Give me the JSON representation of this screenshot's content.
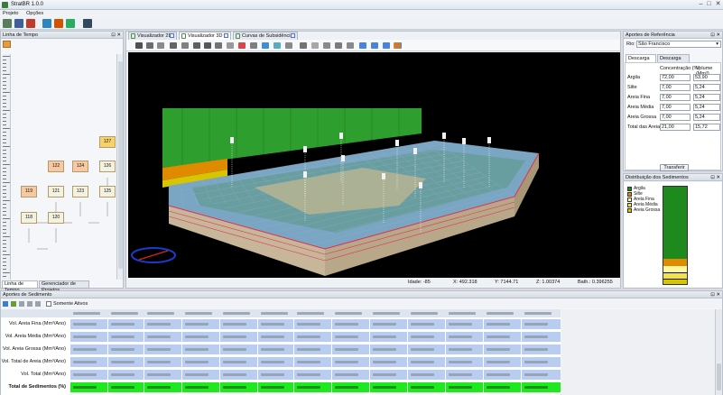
{
  "window": {
    "title": "StratBR 1.0.0"
  },
  "menu": [
    "Projeto",
    "Opções"
  ],
  "left_panel": {
    "title": "Linha de Tempo",
    "tabs": [
      "Linha de Tempo",
      "Gerenciador de Projetos"
    ],
    "nodes": [
      {
        "label": "127",
        "kind": "yellow"
      },
      {
        "label": "122",
        "kind": "orange"
      },
      {
        "label": "124",
        "kind": "orange"
      },
      {
        "label": "126",
        "kind": "plain"
      },
      {
        "label": "119",
        "kind": "orange"
      },
      {
        "label": "121",
        "kind": "plain"
      },
      {
        "label": "123",
        "kind": "plain"
      },
      {
        "label": "125",
        "kind": "plain"
      },
      {
        "label": "118",
        "kind": "plain"
      },
      {
        "label": "120",
        "kind": "plain"
      }
    ]
  },
  "center": {
    "tabs": [
      "Visualizador 2D",
      "Visualizador 3D",
      "Curvas de Subsidência"
    ],
    "active_tab": 1,
    "status": {
      "idade": "Idade: -85",
      "x": "X: 492.318",
      "y": "Y: 7144.71",
      "z": "Z: 1.00374",
      "bath": "Bath.: 0.396255"
    }
  },
  "right_panel": {
    "title": "Aportes de Referência",
    "rio_label": "Rio:",
    "rio_value": "São Francisco",
    "tabs": [
      "Descarga Mínima",
      "Descarga Máxima"
    ],
    "col_headers": [
      "Concentração (%)",
      "Volume (Mm³)"
    ],
    "rows": [
      {
        "name": "Argila",
        "conc": "72,00",
        "vol": "53,90"
      },
      {
        "name": "Silte",
        "conc": "7,00",
        "vol": "5,24"
      },
      {
        "name": "Areia Fina",
        "conc": "7,00",
        "vol": "5,24"
      },
      {
        "name": "Areia Média",
        "conc": "7,00",
        "vol": "5,24"
      },
      {
        "name": "Areia Grossa",
        "conc": "7,00",
        "vol": "5,24"
      },
      {
        "name": "Total das Areias",
        "conc": "21,00",
        "vol": "15,72"
      }
    ],
    "transfer_label": "Transferir",
    "dist_title": "Distribuição dos Sedimentos",
    "legend": [
      {
        "name": "Argila",
        "color": "#1e8a1e"
      },
      {
        "name": "Silte",
        "color": "#e08a00"
      },
      {
        "name": "Areia Fina",
        "color": "#fff7a0"
      },
      {
        "name": "Areia Média",
        "color": "#f2e24a"
      },
      {
        "name": "Areia Grossa",
        "color": "#d8c400"
      }
    ]
  },
  "bottom_panel": {
    "title": "Aportes de Sedimento",
    "checkbox_label": "Somente Ativos",
    "row_labels": [
      "Vol. Areia Fina (Mm³/Ano)",
      "Vol. Areia Média (Mm³/Ano)",
      "Vol. Areia Grossa (Mm³/Ano)",
      "Vol. Total de Areia (Mm³/Ano)",
      "Vol. Total (Mm³/Ano)",
      "Total de Sedimentos (%)"
    ]
  }
}
